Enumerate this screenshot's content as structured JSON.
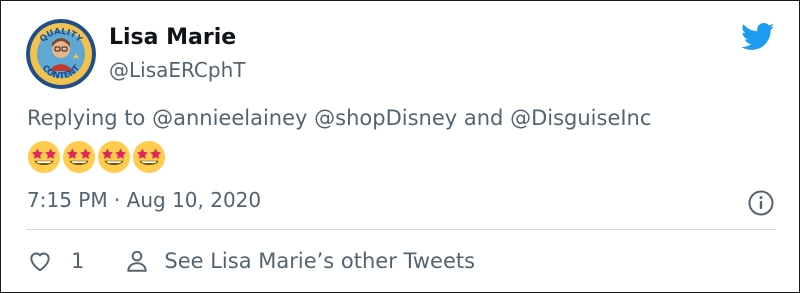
{
  "user": {
    "name": "Lisa Marie",
    "handle": "@LisaERCphT",
    "avatar_badge_top": "QUALITY",
    "avatar_badge_bottom": "CONTENT"
  },
  "tweet": {
    "replying_prefix": "Replying to",
    "mentions": [
      "@annieelainey",
      "@shopDisney",
      "@DisguiseInc"
    ],
    "mention_joiner": "and",
    "emoji_count": 4,
    "emoji": "star-struck",
    "timestamp": "7:15 PM · Aug 10, 2020"
  },
  "actions": {
    "like_count": "1",
    "see_more_label": "See Lisa Marie’s other Tweets"
  },
  "colors": {
    "twitter_blue": "#1d9bf0",
    "secondary_text": "#536471",
    "divider": "#cfd9de"
  },
  "icons": [
    "twitter-bird-icon",
    "info-icon",
    "heart-icon",
    "person-icon"
  ]
}
